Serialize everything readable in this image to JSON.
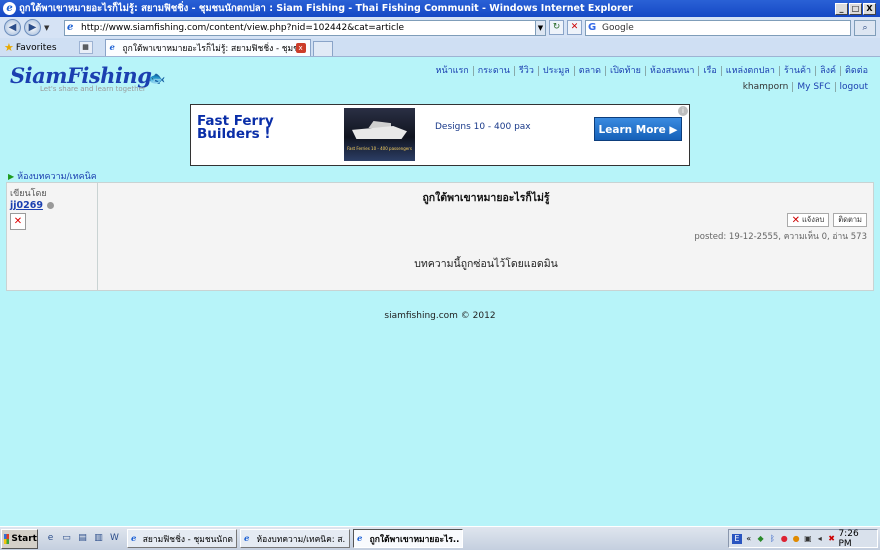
{
  "window": {
    "title": "ถูกใต้พาเขาหมายอะไรก็ไม่รู้: สยามฟิชชิ่ง - ชุมชนนักตกปลา : Siam Fishing - Thai Fishing Communit - Windows Internet Explorer",
    "minimize": "_",
    "maximize": "□",
    "close": "X"
  },
  "browser": {
    "back": "◀",
    "forward": "▶",
    "address": "http://www.siamfishing.com/content/view.php?nid=102442&cat=article",
    "refresh": "↻",
    "stop": "✕",
    "search_value": "Google",
    "search_button": "⌕",
    "favorites_label": "Favorites",
    "tabs": [
      {
        "label": "ถูกใต้พาเขาหมายอะไรก็ไม่รู้: สยามฟิชชิ่ง - ชุมชนนัก..."
      }
    ]
  },
  "site": {
    "logo_text": "SiamFishing",
    "tagline": "Let's share and learn together",
    "topnav": [
      "หน้าแรก",
      "กระดาน",
      "รีวิว",
      "ประมูล",
      "ตลาด",
      "เปิดท้าย",
      "ห้องสนทนา",
      "เรือ",
      "แหล่งตกปลา",
      "ร้านค้า",
      "ลิงค์",
      "ติดต่อ"
    ],
    "username": "khamporn",
    "my_sfc": "My SFC",
    "logout": "logout"
  },
  "ad": {
    "title_line1": "Fast Ferry",
    "title_line2": "Builders !",
    "tagline": "Designs 10 - 400 pax",
    "cta": "Learn More ▶",
    "info": "i",
    "boat_caption": "Fast Ferries 10 - 400 passengers"
  },
  "breadcrumb": {
    "arrow": "▶",
    "label": "ห้องบทความ/เทคนิค"
  },
  "post": {
    "written_by_label": "เขียนโดย",
    "author": "jj0269",
    "avatar_icon": "✕",
    "title": "ถูกใต้พาเขาหมายอะไรก็ไม่รู้",
    "report_icon": "✕",
    "report_label": "แจ้งลบ",
    "follow_label": "ติดตาม",
    "meta": "posted: 19-12-2555, ความเห็น 0, อ่าน 573",
    "hidden_message": "บทความนี้ถูกซ่อนไว้โดยแอดมิน"
  },
  "footer": {
    "copyright": "siamfishing.com © 2012"
  },
  "taskbar": {
    "start": "Start",
    "items": [
      {
        "label": "สยามฟิชชิ่ง - ชุมชนนักตก..."
      },
      {
        "label": "ห้องบทความ/เทคนิค: ส..."
      },
      {
        "label": "ถูกใต้พาเขาหมายอะไร..."
      }
    ],
    "clock": "7:26 PM"
  }
}
